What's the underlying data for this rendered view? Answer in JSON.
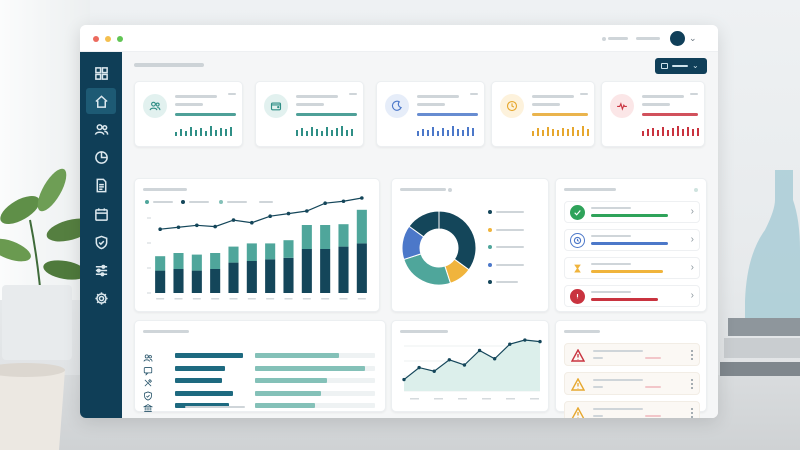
{
  "colors": {
    "sidebar": "#0f3e57",
    "sidebar_active": "#1d5a74",
    "accent_dark": "#103f59",
    "teal_dark": "#14465a",
    "teal": "#4fa69b",
    "blue": "#4c78c9",
    "gold": "#f0b43c",
    "green": "#2fa35a",
    "red": "#c9333f"
  },
  "window": {
    "controls": [
      {
        "name": "close",
        "color": "#ec6a5e"
      },
      {
        "name": "minimize",
        "color": "#f4bf4f"
      },
      {
        "name": "maximize",
        "color": "#61c554"
      }
    ]
  },
  "sidebar": {
    "items": [
      {
        "icon": "grid-icon",
        "active": false
      },
      {
        "icon": "home-icon",
        "active": true
      },
      {
        "icon": "users-icon",
        "active": false
      },
      {
        "icon": "pie-chart-icon",
        "active": false
      },
      {
        "icon": "document-icon",
        "active": false
      },
      {
        "icon": "calendar-icon",
        "active": false
      },
      {
        "icon": "shield-icon",
        "active": false
      },
      {
        "icon": "sliders-icon",
        "active": false
      },
      {
        "icon": "gear-icon",
        "active": false
      }
    ]
  },
  "kpi_cards": [
    {
      "icon": "users-icon",
      "color": "#2f8f86",
      "bg": "#e2f1ef",
      "bars": [
        0.45,
        0.7,
        0.55,
        0.9,
        0.6,
        0.8,
        0.5,
        1.0,
        0.65,
        0.85,
        0.7,
        0.95
      ]
    },
    {
      "icon": "wallet-icon",
      "color": "#2f8f86",
      "bg": "#e2f1ef",
      "bars": [
        0.6,
        0.85,
        0.5,
        0.9,
        0.7,
        0.55,
        0.95,
        0.65,
        0.8,
        1.0,
        0.6,
        0.75
      ]
    },
    {
      "icon": "moon-icon",
      "color": "#4c78c9",
      "bg": "#e6edf9",
      "bars": [
        0.5,
        0.75,
        0.6,
        0.95,
        0.55,
        0.8,
        0.65,
        1.0,
        0.7,
        0.6,
        0.9,
        0.8
      ]
    },
    {
      "icon": "clock-icon",
      "color": "#e6a72e",
      "bg": "#fdf2dc",
      "bars": [
        0.55,
        0.8,
        0.6,
        0.9,
        0.7,
        0.6,
        0.85,
        0.75,
        0.95,
        0.65,
        1.0,
        0.7
      ]
    },
    {
      "icon": "heartbeat-icon",
      "color": "#c9333f",
      "bg": "#fbe6e7",
      "bars": [
        0.5,
        0.7,
        0.85,
        0.6,
        0.9,
        0.65,
        0.8,
        1.0,
        0.7,
        0.9,
        0.75,
        0.85
      ]
    }
  ],
  "chart_data": [
    {
      "type": "bar",
      "series": [
        {
          "values": [
            0.28,
            0.3,
            0.28,
            0.3,
            0.38,
            0.4,
            0.42,
            0.44,
            0.55,
            0.55,
            0.58,
            0.62
          ]
        },
        {
          "values": [
            0.18,
            0.2,
            0.2,
            0.2,
            0.2,
            0.22,
            0.2,
            0.22,
            0.3,
            0.3,
            0.28,
            0.42
          ]
        }
      ],
      "line": [
        0.52,
        0.55,
        0.58,
        0.56,
        0.66,
        0.62,
        0.72,
        0.76,
        0.8,
        0.92,
        0.95,
        1.0
      ],
      "ylim": [
        0,
        1
      ]
    },
    {
      "type": "pie",
      "donut": true,
      "slices": [
        {
          "value": 35,
          "color": "#14465a"
        },
        {
          "value": 10,
          "color": "#f0b43c"
        },
        {
          "value": 25,
          "color": "#4fa69b"
        },
        {
          "value": 15,
          "color": "#4c78c9"
        },
        {
          "value": 15,
          "color": "#14465a"
        }
      ]
    },
    {
      "type": "area",
      "values": [
        0.22,
        0.45,
        0.38,
        0.6,
        0.5,
        0.78,
        0.62,
        0.9,
        0.98,
        0.95
      ],
      "ylim": [
        0,
        1
      ]
    },
    {
      "type": "bar",
      "orientation": "horizontal",
      "rows": [
        {
          "icon": "users-icon",
          "primary": 0.95,
          "secondary": 0.7
        },
        {
          "icon": "chat-icon",
          "primary": 0.7,
          "secondary": 0.92
        },
        {
          "icon": "tools-icon",
          "primary": 0.65,
          "secondary": 0.6
        },
        {
          "icon": "shield-icon",
          "primary": 0.8,
          "secondary": 0.55
        },
        {
          "icon": "bank-icon",
          "primary": 0.75,
          "secondary": 0.5
        }
      ]
    }
  ],
  "checklist": [
    {
      "icon": "check-circle-icon",
      "color": "#2fa35a",
      "progress": 0.8
    },
    {
      "icon": "clock-icon",
      "color": "#4c78c9",
      "progress": 0.8
    },
    {
      "icon": "hourglass-icon",
      "color": "#f0b43c",
      "progress": 0.75
    },
    {
      "icon": "alert-circle-icon",
      "color": "#c9333f",
      "progress": 0.7
    }
  ],
  "alerts": [
    {
      "icon": "warning-icon",
      "color": "#c9333f"
    },
    {
      "icon": "warning-icon",
      "color": "#e6a72e"
    },
    {
      "icon": "warning-icon",
      "color": "#e6a72e"
    }
  ]
}
